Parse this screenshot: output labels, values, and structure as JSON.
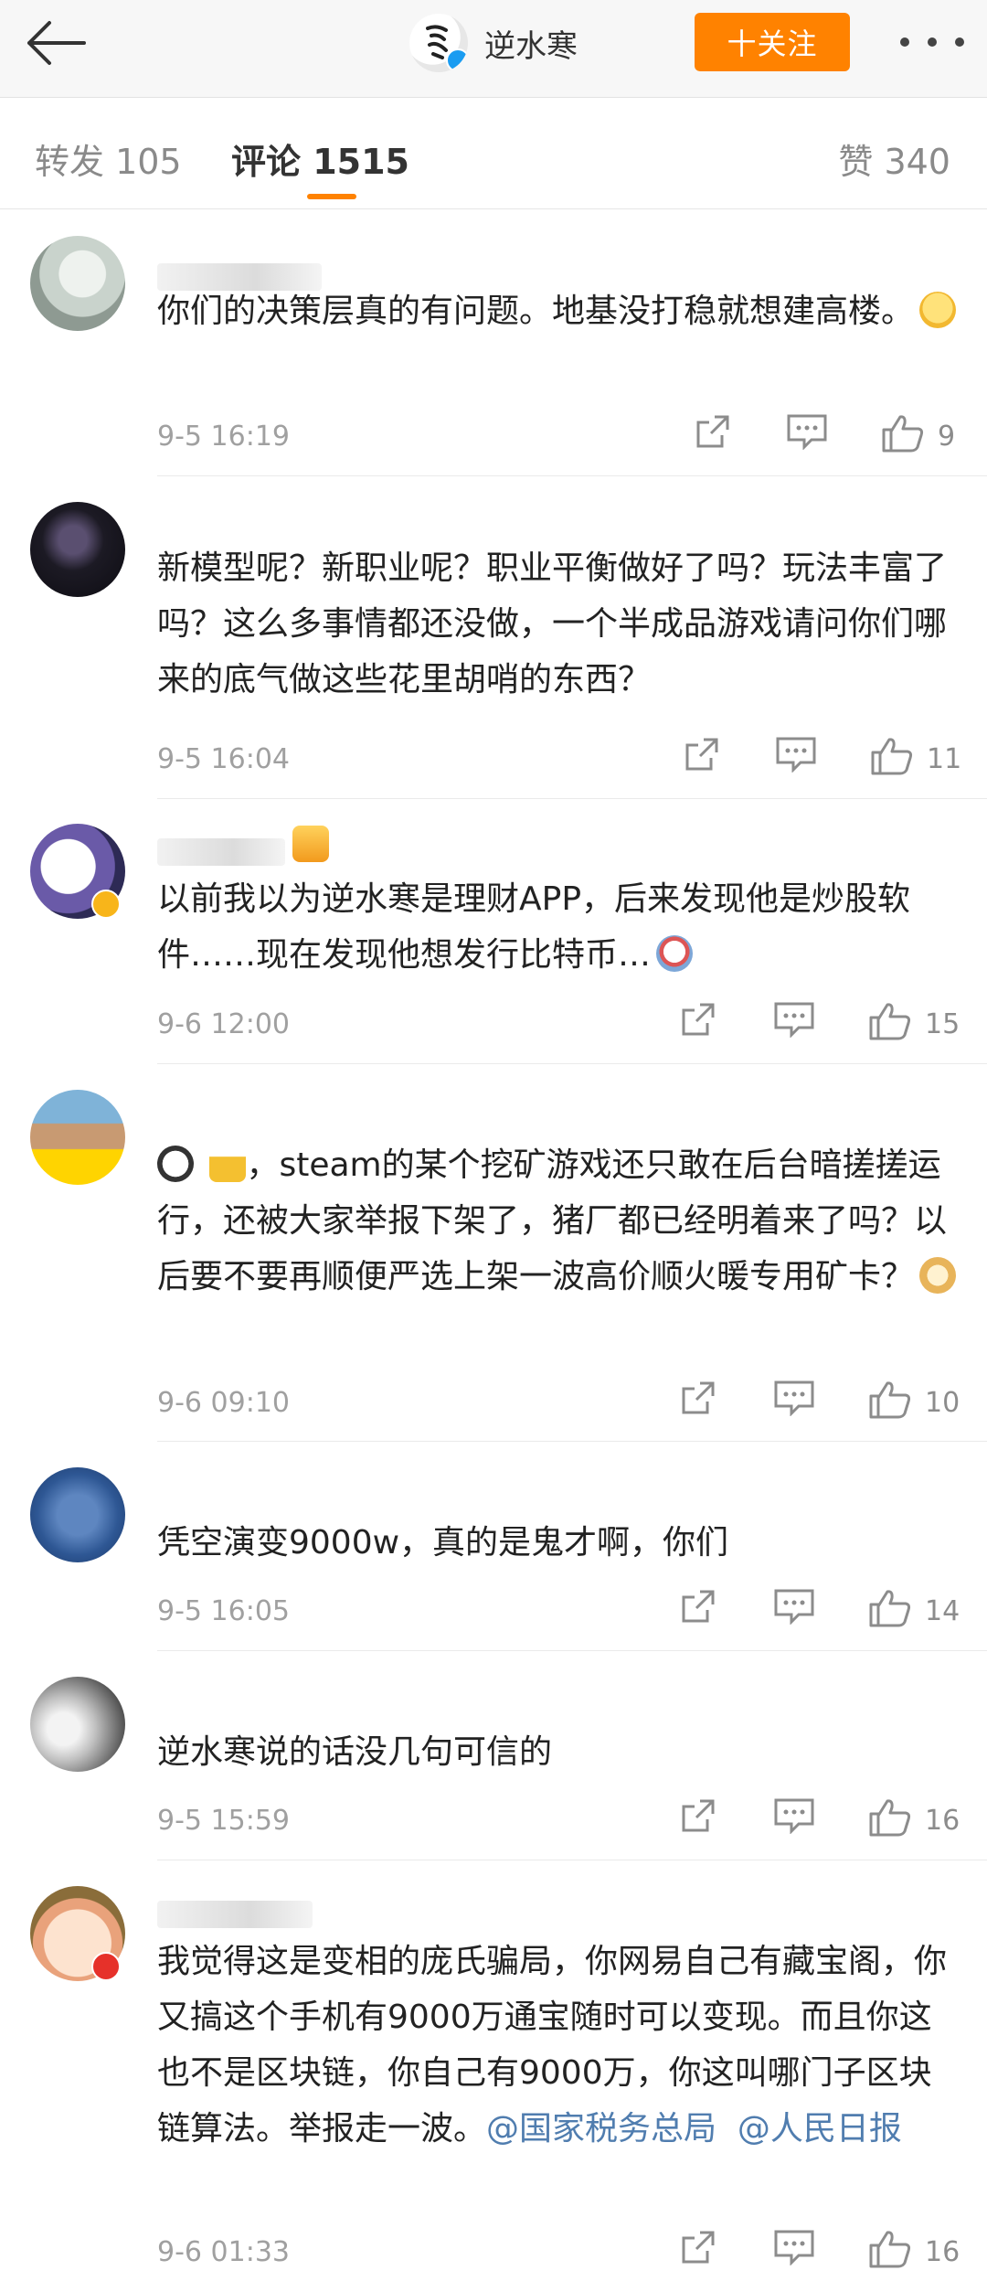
{
  "header": {
    "title": "逆水寒",
    "follow_label": "十关注"
  },
  "tabs": {
    "repost": "转发 105",
    "comment": "评论 1515",
    "like": "赞 340"
  },
  "colors": {
    "accent": "#ff8200",
    "link": "#507daf",
    "verified": "#1a9cf1"
  },
  "comments": [
    {
      "text": "你们的决策层真的有问题。地基没打稳就想建高楼。",
      "emoji": "smile",
      "time": "9-5 16:19",
      "likes": "9"
    },
    {
      "text": "新模型呢？新职业呢？职业平衡做好了吗？玩法丰富了吗？这么多事情都还没做，一个半成品游戏请问你们哪来的底气做这些花里胡哨的东西？",
      "time": "9-5 16:04",
      "likes": "11"
    },
    {
      "text": "以前我以为逆水寒是理财APP，后来发现他是炒股软件……现在发现他想发行比特币…",
      "emoji": "crazy-face",
      "time": "9-6 12:00",
      "likes": "15"
    },
    {
      "text": "，steam的某个挖矿游戏还只敢在后台暗搓搓运行，还被大家举报下架了，猪厂都已经明着来了吗？以后要不要再顺便严选上架一波高价顺火暖专用矿卡？",
      "time": "9-6 09:10",
      "likes": "10"
    },
    {
      "text": "凭空演变9000w，真的是鬼才啊，你们",
      "time": "9-5 16:05",
      "likes": "14"
    },
    {
      "text": "逆水寒说的话没几句可信的",
      "time": "9-5 15:59",
      "likes": "16"
    },
    {
      "text": "我觉得这是变相的庞氏骗局，你网易自己有藏宝阁，你又搞这个手机有9000万通宝随时可以变现。而且你这也不是区块链，你自己有9000万，你这叫哪门子区块链算法。举报走一波。",
      "mention1": "@国家税务总局",
      "mention2": "@人民日报",
      "time": "9-6 01:33",
      "likes": "16"
    }
  ]
}
